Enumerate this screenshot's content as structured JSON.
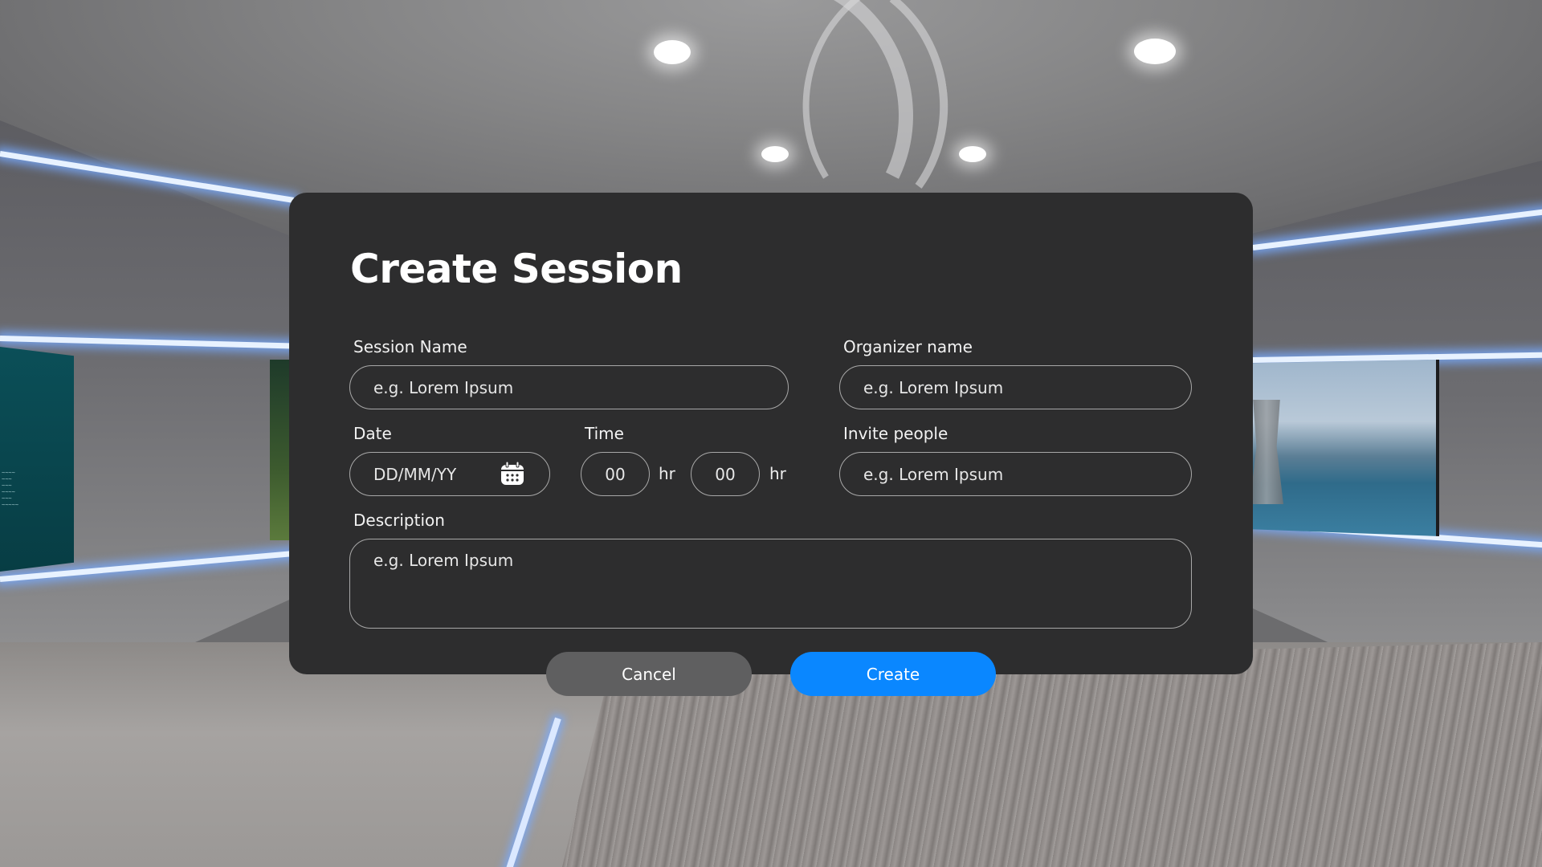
{
  "dialog": {
    "title": "Create Session",
    "session_name": {
      "label": "Session Name",
      "placeholder": "e.g. Lorem Ipsum"
    },
    "organizer_name": {
      "label": "Organizer name",
      "placeholder": "e.g. Lorem Ipsum"
    },
    "date": {
      "label": "Date",
      "placeholder": "DD/MM/YY",
      "icon": "calendar-icon"
    },
    "time": {
      "label": "Time",
      "hours_value": "00",
      "hours_unit": "hr",
      "minutes_value": "00",
      "minutes_unit": "hr"
    },
    "invite_people": {
      "label": "Invite people",
      "placeholder": "e.g. Lorem Ipsum"
    },
    "description": {
      "label": "Description",
      "placeholder": "e.g. Lorem Ipsum"
    },
    "cancel_label": "Cancel",
    "create_label": "Create"
  },
  "colors": {
    "dialog_background": "#2d2d2e",
    "primary_button": "#0a87ff",
    "secondary_button": "#5f5f60",
    "field_border": "#a8a8a8"
  }
}
